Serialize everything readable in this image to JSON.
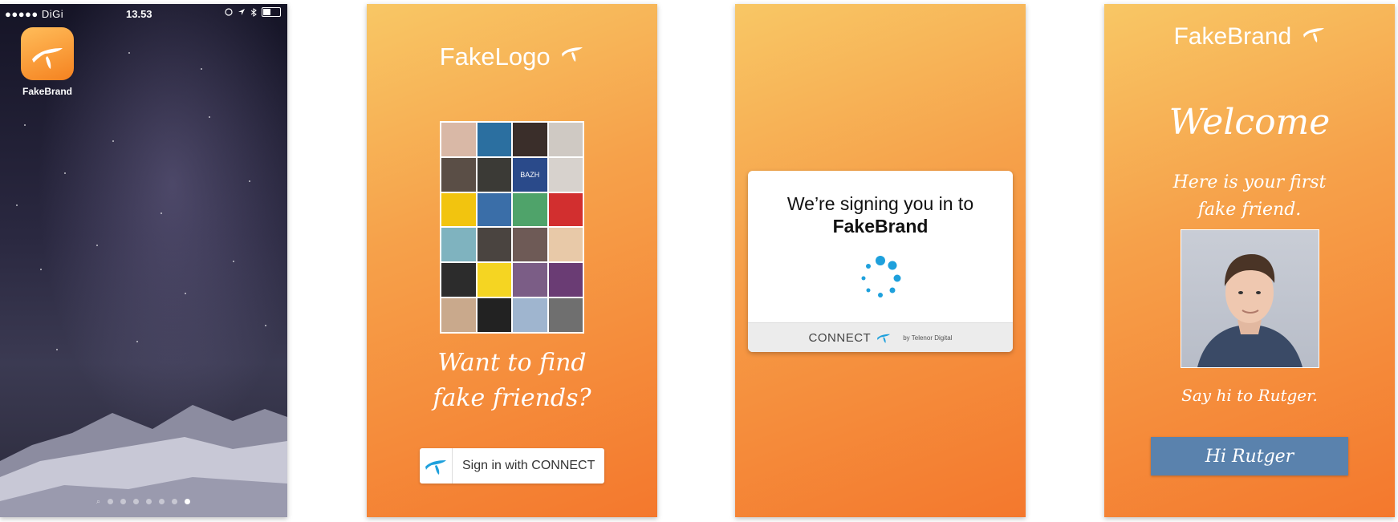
{
  "home": {
    "status": {
      "carrier": "●●●●● DiGi",
      "time": "13.53"
    },
    "app_label": "FakeBrand"
  },
  "login": {
    "logo": "FakeLogo",
    "headline_1": "Want to find",
    "headline_2": "fake friends?",
    "signin_label": "Sign in with CONNECT",
    "tile_text": "BAZH"
  },
  "signing": {
    "line1": "We’re signing you in to",
    "line2": "FakeBrand",
    "footer_brand": "CONNECT",
    "footer_by": "by Telenor Digital"
  },
  "welcome": {
    "logo": "FakeBrand",
    "title": "Welcome",
    "sub1": "Here is your first",
    "sub2": "fake friend.",
    "caption": "Say hi to Rutger.",
    "button_label": "Hi Rutger"
  },
  "colors": {
    "accent_orange": "#f58220",
    "connect_blue": "#1ea0dc",
    "hi_button": "#5a82ad"
  }
}
